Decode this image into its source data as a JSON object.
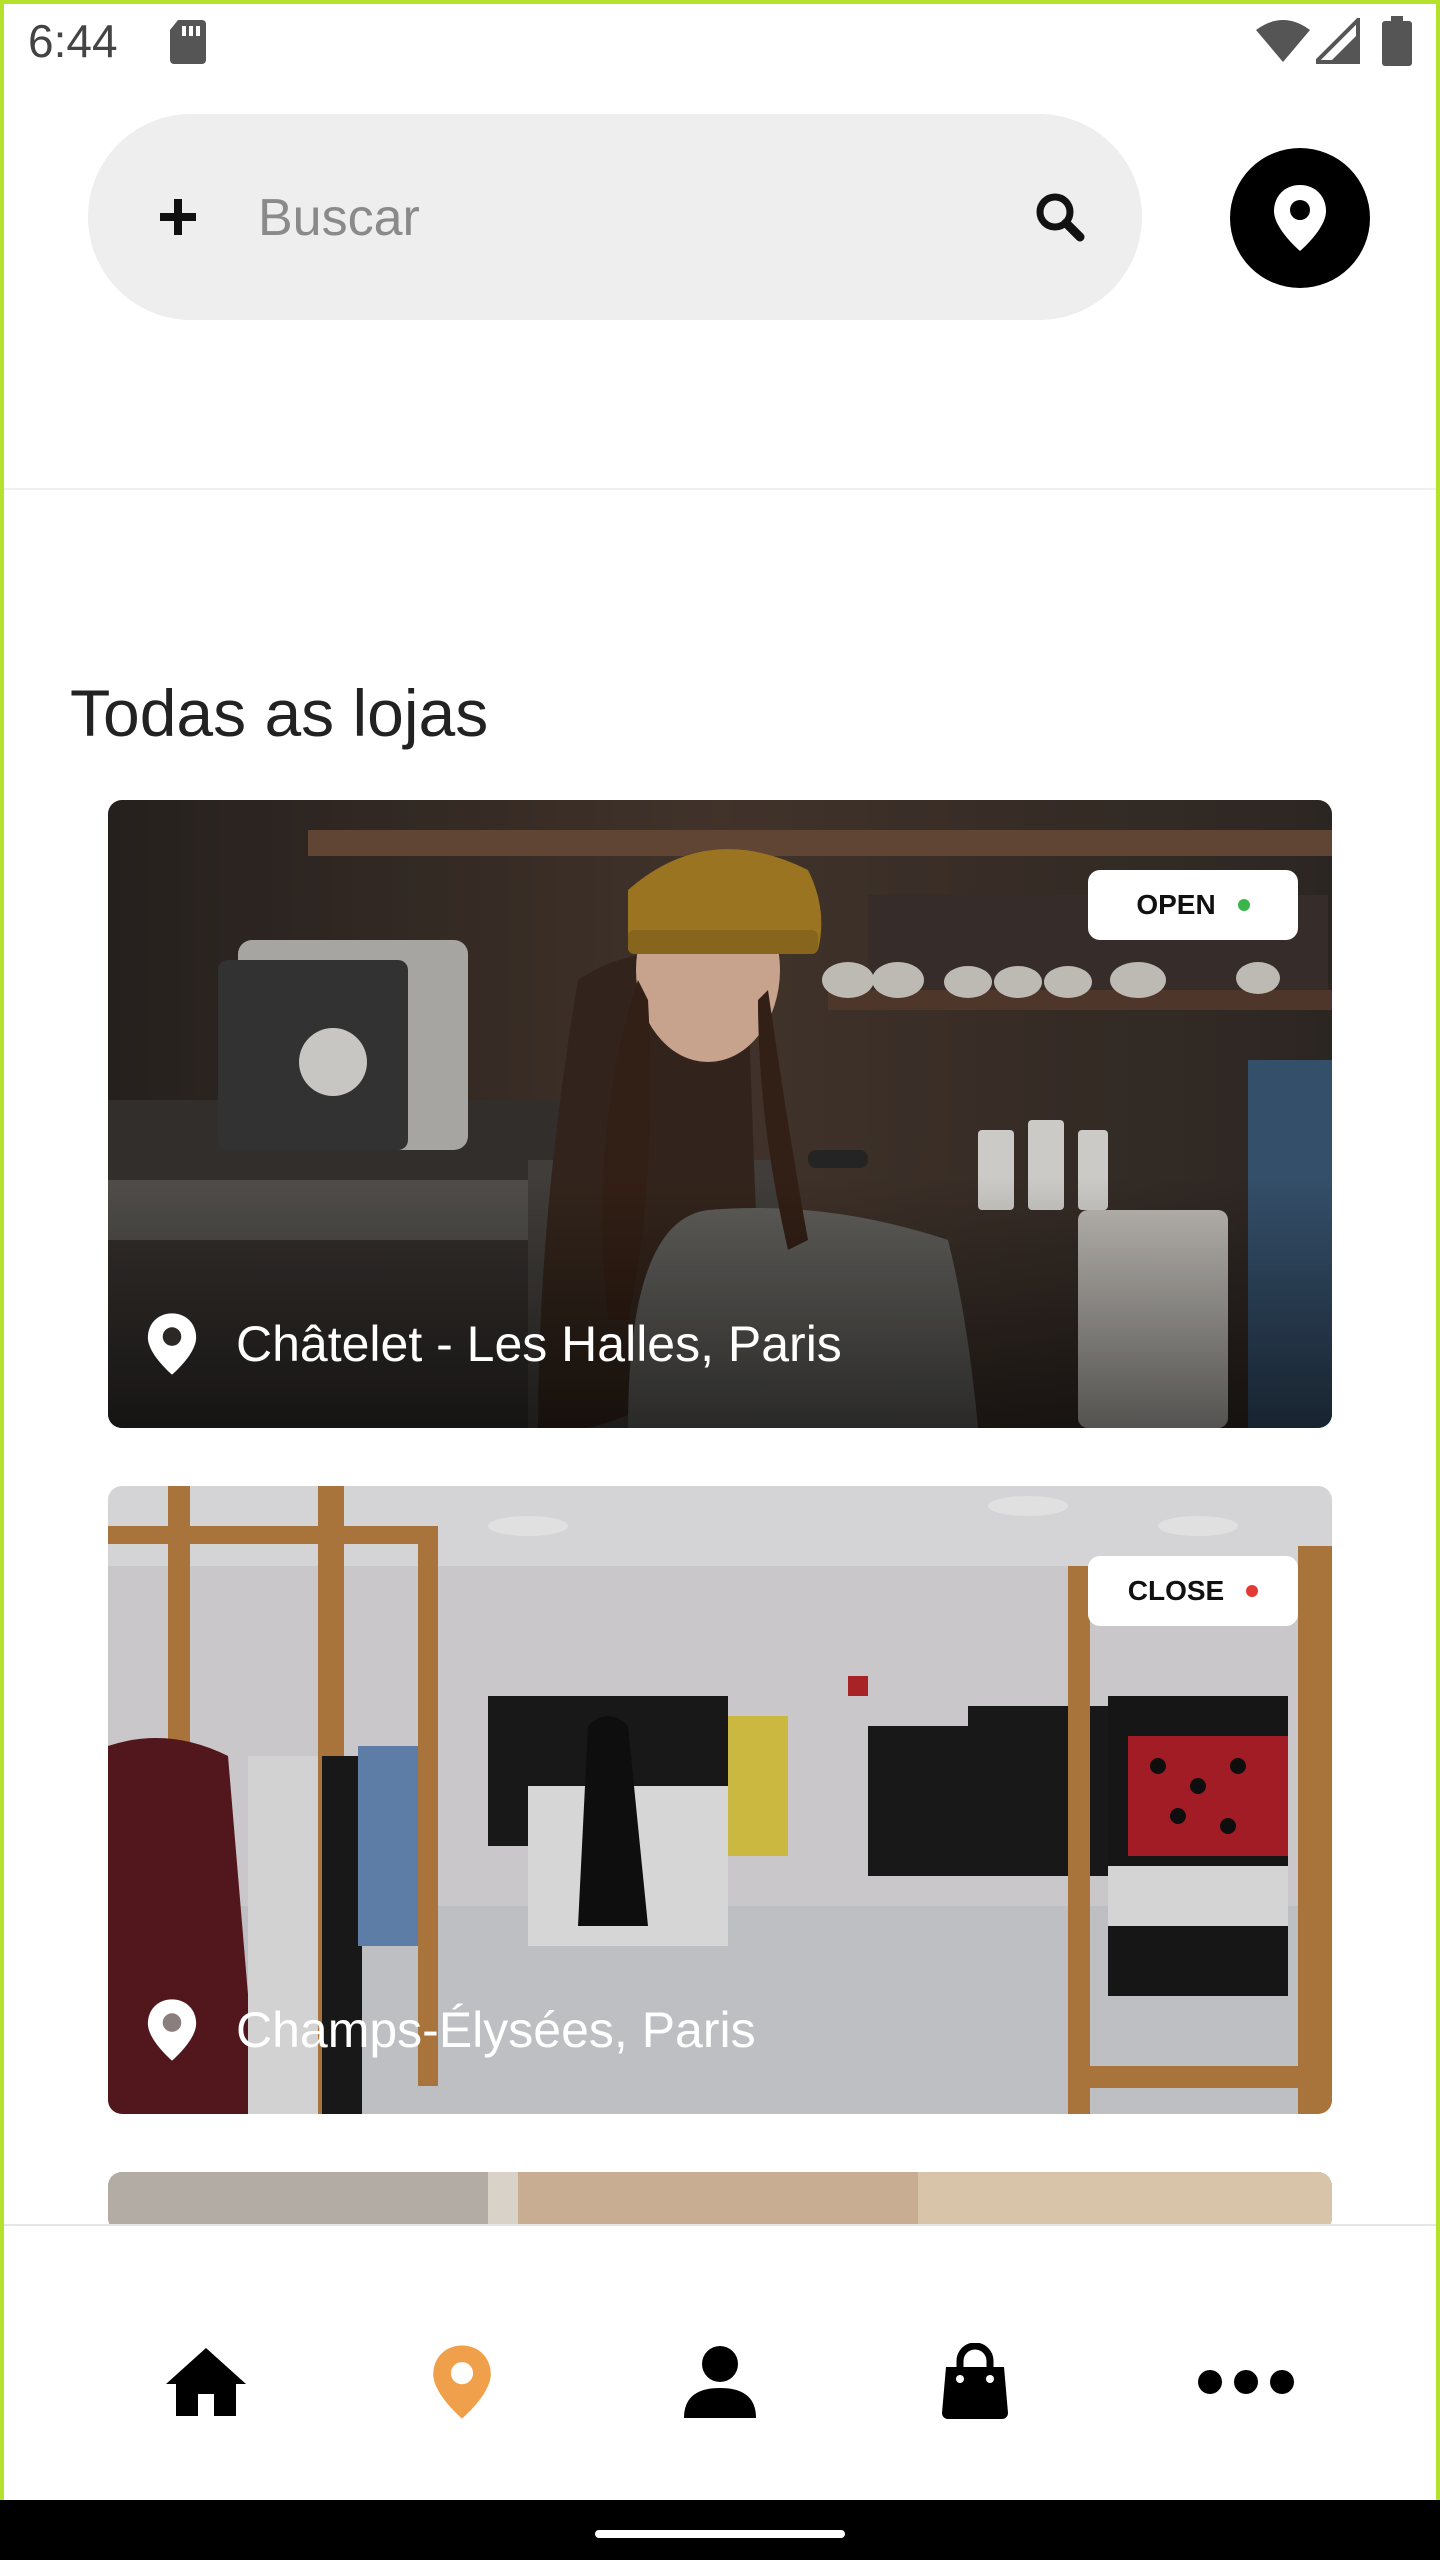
{
  "status_bar": {
    "time": "6:44"
  },
  "search": {
    "placeholder": "Buscar"
  },
  "section": {
    "title": "Todas as lojas"
  },
  "stores": [
    {
      "location": "Châtelet - Les Halles, Paris",
      "status": "OPEN",
      "status_color": "#3bb54a"
    },
    {
      "location": "Champs-Élysées, Paris",
      "status": "CLOSE",
      "status_color": "#e53935"
    }
  ],
  "bottom_nav": {
    "items": [
      {
        "icon": "home-icon",
        "active": false
      },
      {
        "icon": "map-pin-icon",
        "active": true
      },
      {
        "icon": "user-icon",
        "active": false
      },
      {
        "icon": "shopping-bag-icon",
        "active": false
      },
      {
        "icon": "more-icon",
        "active": false
      }
    ],
    "active_color": "#f0a04b",
    "inactive_color": "#000000"
  },
  "colors": {
    "frame": "#b5e12a",
    "search_bg": "#eeeeee"
  }
}
